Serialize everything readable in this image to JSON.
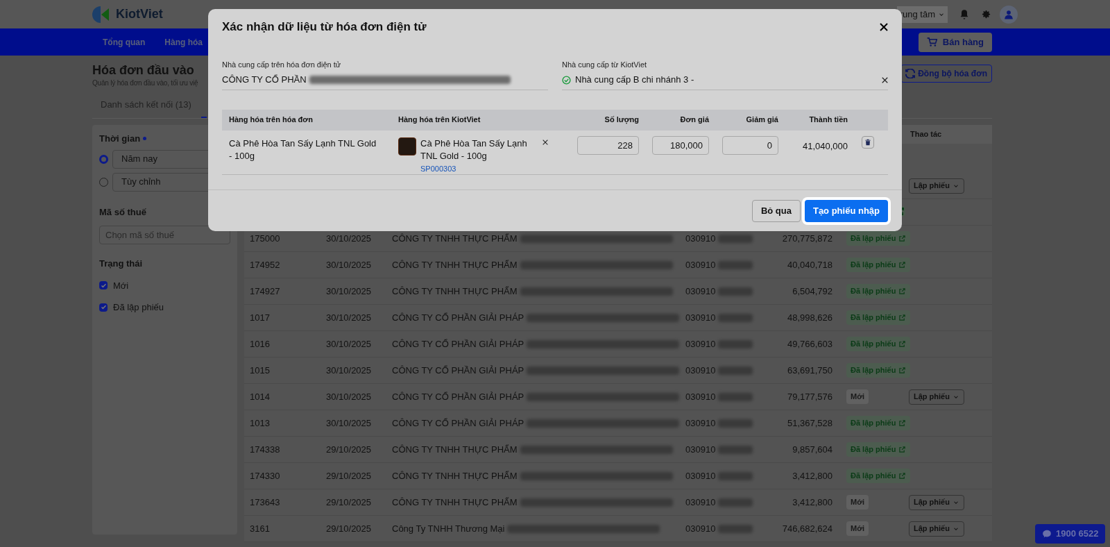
{
  "header": {
    "logo": "KiotViet",
    "branch": "rung tâm"
  },
  "nav": {
    "items": [
      {
        "label": "Tổng quan"
      },
      {
        "label": "Hàng hóa"
      }
    ],
    "sell_button": "Bán hàng"
  },
  "page": {
    "title": "Hóa đơn đầu vào",
    "subtitle": "Quản lý hóa đơn đầu vào, tối ưu việ",
    "sync_button": "Đồng bộ hóa đơn"
  },
  "tabs": [
    {
      "label": "Danh sách kết nối (13)",
      "selected": false
    },
    {
      "selected": true
    }
  ],
  "filters": {
    "time": {
      "label": "Thời gian",
      "options": [
        {
          "label": "Năm nay",
          "selected": true
        },
        {
          "label": "Tùy chỉnh",
          "selected": false
        }
      ]
    },
    "tax": {
      "label": "Mã số thuế",
      "placeholder": "Chọn mã số thuế"
    },
    "status": {
      "label": "Trạng thái",
      "options": [
        {
          "label": "Mới",
          "checked": true
        },
        {
          "label": "Đã lập phiếu",
          "checked": true
        }
      ]
    }
  },
  "table": {
    "columns": [
      "Thao tác"
    ],
    "rows": [
      {
        "action": "Lập phiếu"
      },
      {
        "status": {
          "kind": "done"
        }
      },
      {
        "id": "175000",
        "date": "30/10/2025",
        "company": "CÔNG TY TNHH THỰC PHẨM",
        "tax_code": "030910",
        "amount": "270,775,872",
        "status": {
          "kind": "done",
          "label": "Đã lập phiếu"
        }
      },
      {
        "id": "174952",
        "date": "30/10/2025",
        "company": "CÔNG TY TNHH THỰC PHẨM",
        "tax_code": "030910",
        "amount": "40,040,718",
        "status": {
          "kind": "done",
          "label": "Đã lập phiếu"
        }
      },
      {
        "id": "174927",
        "date": "30/10/2025",
        "company": "CÔNG TY TNHH THỰC PHẨM",
        "tax_code": "030910",
        "amount": "6,504,792",
        "status": {
          "kind": "done",
          "label": "Đã lập phiếu"
        }
      },
      {
        "id": "1017",
        "date": "30/10/2025",
        "company": "CÔNG TY CỔ PHẦN GIẢI PHÁP",
        "tax_code": "030910",
        "amount": "48,998,626",
        "status": {
          "kind": "done",
          "label": "Đã lập phiếu"
        }
      },
      {
        "id": "1016",
        "date": "30/10/2025",
        "company": "CÔNG TY CỔ PHẦN GIẢI PHÁP",
        "tax_code": "030910",
        "amount": "49,766,603",
        "status": {
          "kind": "done",
          "label": "Đã lập phiếu"
        }
      },
      {
        "id": "1015",
        "date": "30/10/2025",
        "company": "CÔNG TY CỔ PHẦN GIẢI PHÁP",
        "tax_code": "030910",
        "amount": "63,691,750",
        "status": {
          "kind": "done",
          "label": "Đã lập phiếu"
        }
      },
      {
        "id": "1014",
        "date": "30/10/2025",
        "company": "CÔNG TY CỔ PHẦN GIẢI PHÁP",
        "tax_code": "030910",
        "amount": "79,177,576",
        "status": {
          "kind": "new",
          "label": "Mới"
        },
        "action": "Lập phiếu"
      },
      {
        "id": "1013",
        "date": "30/10/2025",
        "company": "CÔNG TY CỔ PHẦN GIẢI PHÁP",
        "tax_code": "030910",
        "amount": "51,367,528",
        "status": {
          "kind": "done",
          "label": "Đã lập phiếu"
        }
      },
      {
        "id": "174338",
        "date": "29/10/2025",
        "company": "CÔNG TY TNHH THỰC PHẨM",
        "tax_code": "030910",
        "amount": "9,857,604",
        "status": {
          "kind": "done",
          "label": "Đã lập phiếu"
        }
      },
      {
        "id": "174330",
        "date": "29/10/2025",
        "company": "CÔNG TY TNHH THỰC PHẨM",
        "tax_code": "030910",
        "amount": "3,412,800",
        "status": {
          "kind": "done",
          "label": "Đã lập phiếu"
        }
      },
      {
        "id": "173643",
        "date": "29/10/2025",
        "company": "CÔNG TY TNHH THỰC PHẨM",
        "tax_code": "030910",
        "amount": "3,412,800",
        "status": {
          "kind": "new",
          "label": "Mới"
        },
        "action": "Lập phiếu"
      },
      {
        "id": "3161",
        "date": "29/10/2025",
        "company": "Công Ty TNHH Thương Mại",
        "tax_code": "030910",
        "amount": "746,682,624",
        "status": {
          "kind": "new",
          "label": "Mới"
        },
        "action": "Lập phiếu"
      }
    ]
  },
  "modal": {
    "title": "Xác nhận dữ liệu từ hóa đơn điện tử",
    "invoice_supplier": {
      "label": "Nhà cung cấp trên hóa đơn điện tử",
      "value": "CÔNG TY CỔ PHẦN"
    },
    "kiotviet_supplier": {
      "label": "Nhà cung cấp từ KiotViet",
      "value": "Nhà cung cấp B chi nhánh 3 -",
      "matched": true
    },
    "columns": [
      "Hàng hóa trên hóa đơn",
      "Hàng hóa trên KiotViet",
      "Số lượng",
      "Đơn giá",
      "Giảm giá",
      "Thành tiền"
    ],
    "items": [
      {
        "invoice_name": "Cà Phê Hòa Tan Sấy Lạnh TNL Gold - 100g",
        "product_name": "Cà Phê Hòa Tan Sấy Lạnh TNL Gold - 100g",
        "product_code": "SP000303",
        "quantity": "228",
        "price": "180,000",
        "discount": "0",
        "total": "41,040,000"
      }
    ],
    "cancel_button": "Bỏ qua",
    "confirm_button": "Tạo phiếu nhập"
  },
  "chat": {
    "label": "1900 6522"
  }
}
